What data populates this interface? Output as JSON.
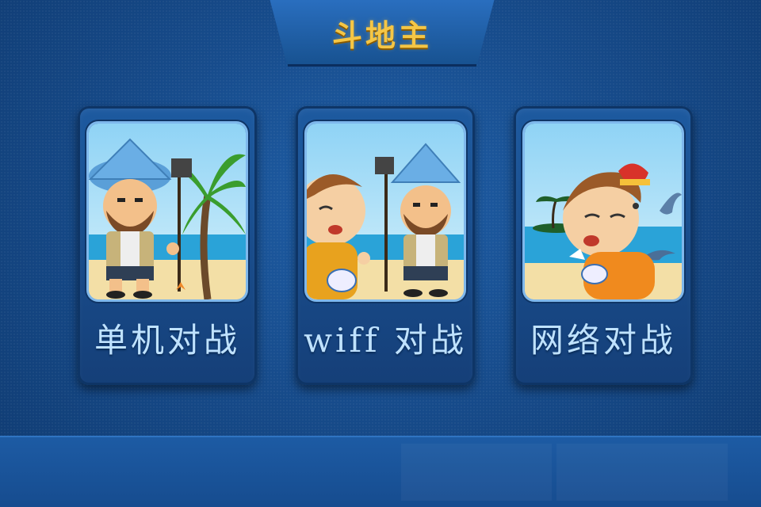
{
  "header": {
    "title": "斗地主"
  },
  "modes": [
    {
      "label": "单机对战",
      "icon": "single-player-scene"
    },
    {
      "label": "wiff 对战",
      "icon": "wifi-two-player-scene"
    },
    {
      "label": "网络对战",
      "icon": "network-player-scene"
    }
  ],
  "colors": {
    "title": "#f5c645",
    "label": "#bfe2ff",
    "background": "#174c8c"
  }
}
